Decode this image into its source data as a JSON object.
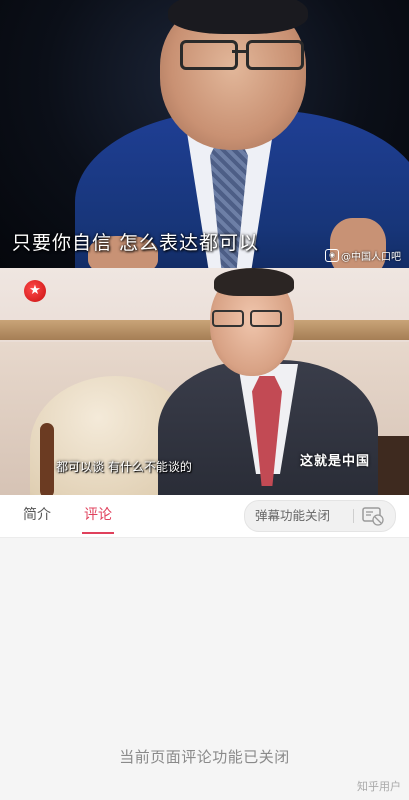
{
  "video_top": {
    "caption": "只要你自信 怎么表达都可以",
    "watermark": "@中国人口吧",
    "watermark_icon": "weibo-icon"
  },
  "video_mid": {
    "channel_logo_icon": "dragon-tv-star-icon",
    "caption": "都可以谈 有什么不能谈的",
    "show_title": "这就是中国"
  },
  "tabs": [
    {
      "label": "简介",
      "active": false
    },
    {
      "label": "评论",
      "active": true
    }
  ],
  "danmaku": {
    "label": "弹幕功能关闭",
    "toggle_icon": "danmaku-toggle-icon"
  },
  "comments": {
    "status_text": "当前页面评论功能已关闭"
  },
  "footer_watermark": "知乎用户",
  "colors": {
    "accent": "#e0415c"
  }
}
